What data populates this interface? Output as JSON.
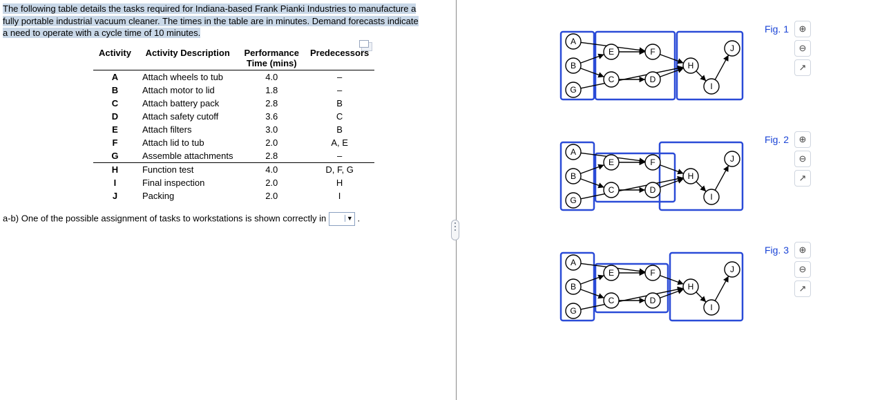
{
  "intro": {
    "l1": "The following table details the tasks required for Indiana-based Frank Pianki Industries to manufacture a",
    "l2": "fully portable industrial vacuum cleaner. The times in the table are in minutes. Demand forecasts indicate",
    "l3a": "a need to operate with a cycle time of ",
    "l3b": "10",
    "l3c": " minutes."
  },
  "headers": {
    "c0": "Activity",
    "c1": "Activity Description",
    "c2a": "Performance",
    "c2b": "Time (mins)",
    "c3": "Predecessors"
  },
  "rows": [
    {
      "a": "A",
      "d": "Attach wheels to tub",
      "t": "4.0",
      "p": "–"
    },
    {
      "a": "B",
      "d": "Attach motor to lid",
      "t": "1.8",
      "p": "–"
    },
    {
      "a": "C",
      "d": "Attach battery pack",
      "t": "2.8",
      "p": "B"
    },
    {
      "a": "D",
      "d": "Attach safety cutoff",
      "t": "3.6",
      "p": "C"
    },
    {
      "a": "E",
      "d": "Attach filters",
      "t": "3.0",
      "p": "B"
    },
    {
      "a": "F",
      "d": "Attach lid to tub",
      "t": "2.0",
      "p": "A, E"
    },
    {
      "a": "G",
      "d": "Assemble attachments",
      "t": "2.8",
      "p": "–"
    },
    {
      "a": "H",
      "d": "Function test",
      "t": "4.0",
      "p": "D, F, G"
    },
    {
      "a": "I",
      "d": "Final inspection",
      "t": "2.0",
      "p": "H"
    },
    {
      "a": "J",
      "d": "Packing",
      "t": "2.0",
      "p": "I"
    }
  ],
  "question": {
    "text": "a-b) One of the possible assignment of tasks to workstations is shown correctly in",
    "period": "."
  },
  "figs": {
    "f1": "Fig. 1",
    "f2": "Fig. 2",
    "f3": "Fig. 3"
  },
  "nodes": [
    "A",
    "B",
    "C",
    "D",
    "E",
    "F",
    "G",
    "H",
    "I",
    "J"
  ]
}
